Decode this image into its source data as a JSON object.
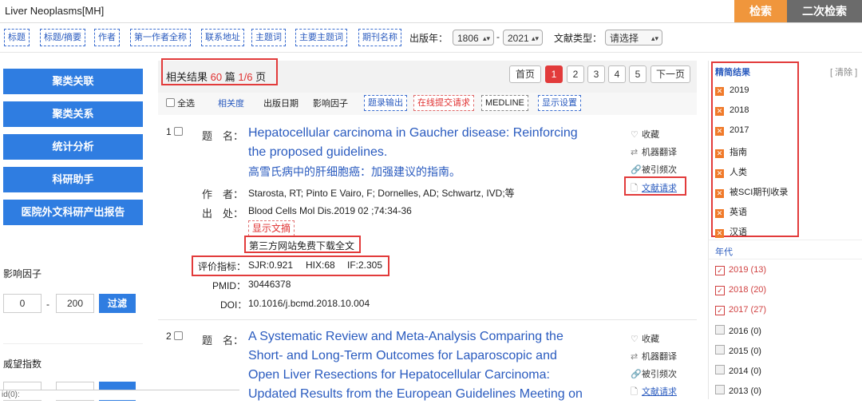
{
  "top": {
    "query": "Liver Neoplasms[MH]",
    "search": "检索",
    "secondary_search": "二次检索"
  },
  "fields": {
    "tags": [
      "标题",
      "标题/摘要",
      "作者",
      "第一作者全称",
      "联系地址",
      "主题词",
      "主要主题词",
      "期刊名称"
    ],
    "year_label": "出版年：",
    "year_from": "1806",
    "dash": "-",
    "year_to": "2021",
    "type_label": "文献类型：",
    "type_value": "请选择"
  },
  "left": {
    "buttons": [
      "聚类关联",
      "聚类关系",
      "统计分析",
      "科研助手",
      "医院外文科研产出报告"
    ],
    "impact_label": "影响因子",
    "impact_min": "0",
    "impact_sep": "-",
    "impact_max": "200",
    "filter": "过滤",
    "prestige_label": "威望指数",
    "footer": "id(0):"
  },
  "results": {
    "prefix": "相关结果",
    "count": "60",
    "unit": "篇",
    "pages": "1/6",
    "page_unit": "页",
    "pager": {
      "first": "首页",
      "pages": [
        "1",
        "2",
        "3",
        "4",
        "5"
      ],
      "next": "下一页"
    }
  },
  "sortbar": {
    "select_all": "全选",
    "relevance": "相关度",
    "pubdate": "出版日期",
    "impact": "影响因子",
    "export": "题录输出",
    "submit": "在线提交请求",
    "medline": "MEDLINE",
    "display": "显示设置"
  },
  "record1": {
    "num": "1",
    "title_label": "题　名：",
    "title_en": [
      "Hepatocellular carcinoma in Gaucher disease: Reinforcing",
      "the proposed guidelines."
    ],
    "title_cn": "高雪氏病中的肝细胞癌：加强建议的指南。",
    "author_label": "作　者：",
    "authors": "Starosta, RT; Pinto E Vairo, F; Dornelles, AD; Schwartz, IVD;等",
    "source_label": "出　处：",
    "source": "Blood Cells Mol Dis.2019 02 ;74:34-36",
    "show_abstract": "显示文摘",
    "free_download": "第三方网站免费下载全文",
    "metrics_label": "评价指标：",
    "sjr": "SJR:0.921",
    "hix": "HIX:68",
    "if": "IF:2.305",
    "pmid_label": "PMID：",
    "pmid": "30446378",
    "doi_label": "DOI：",
    "doi": "10.1016/j.bcmd.2018.10.004",
    "actions": {
      "fav": "收藏",
      "translate": "机器翻译",
      "cited": "被引频次",
      "request": "文献请求"
    }
  },
  "record2": {
    "num": "2",
    "title_label": "题　名：",
    "title_en": [
      "A Systematic Review and Meta-Analysis Comparing the",
      "Short- and Long-Term Outcomes for Laparoscopic and",
      "Open Liver Resections for Hepatocellular Carcinoma:",
      "Updated Results from the European Guidelines Meeting on"
    ],
    "actions": {
      "fav": "收藏",
      "translate": "机器翻译",
      "cited": "被引频次",
      "request": "文献请求"
    }
  },
  "right": {
    "refine_title": "精简结果",
    "clear": "[ 清除 ]",
    "refine": [
      "2019",
      "2018",
      "2017",
      "指南",
      "人类",
      "被SCI期刊收录",
      "英语",
      "汉语"
    ],
    "year_title": "年代",
    "years": [
      {
        "label": "2019 (13)",
        "checked": true
      },
      {
        "label": "2018 (20)",
        "checked": true
      },
      {
        "label": "2017 (27)",
        "checked": true
      },
      {
        "label": "2016 (0)",
        "checked": false
      },
      {
        "label": "2015 (0)",
        "checked": false
      },
      {
        "label": "2014 (0)",
        "checked": false
      },
      {
        "label": "2013 (0)",
        "checked": false
      }
    ]
  },
  "colors": {
    "accent": "#f0963c",
    "primary": "#2f7de1",
    "highlight": "#e23b3b",
    "link": "#2a5bbf"
  }
}
